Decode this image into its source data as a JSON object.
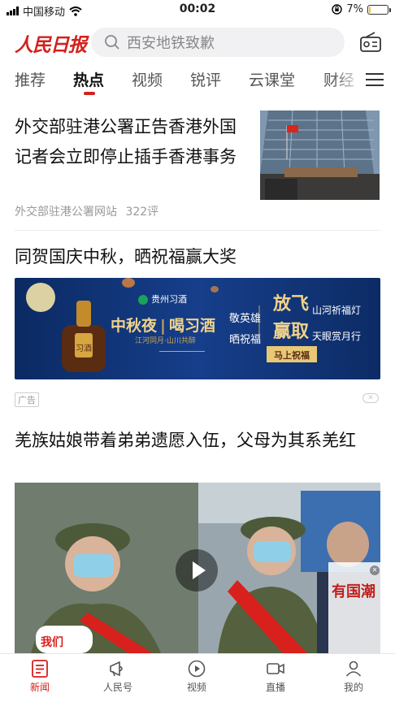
{
  "status_bar": {
    "carrier": "中国移动",
    "time": "00:02",
    "battery_percent": "7%",
    "battery_level": 0.07,
    "icons": [
      "signal-icon",
      "wifi-icon",
      "orientation-lock-icon",
      "battery-icon"
    ]
  },
  "header": {
    "logo_text": "人民日报",
    "search_placeholder": "西安地铁致歉",
    "search_icon": "search-icon",
    "radio_icon": "radio-icon"
  },
  "tabs": [
    {
      "label": "推荐",
      "active": false
    },
    {
      "label": "热点",
      "active": true
    },
    {
      "label": "视频",
      "active": false
    },
    {
      "label": "锐评",
      "active": false
    },
    {
      "label": "云课堂",
      "active": false
    },
    {
      "label": "财经",
      "active": false
    }
  ],
  "tab_menu_icon": "menu-icon",
  "feed": {
    "article1": {
      "title": "外交部驻港公署正告香港外国记者会立即停止插手香港事务",
      "source": "外交部驻港公署网站",
      "comments": "322评"
    },
    "article2": {
      "title": "同贺国庆中秋，晒祝福赢大奖",
      "ad": {
        "brand": "贵州习酒",
        "line1_a": "中秋夜",
        "line1_b": "喝习酒",
        "sub": "江河同月·山川共醉",
        "p1": "敬英雄",
        "p2": "晒祝福",
        "big1": "放飞",
        "big2": "赢取",
        "r1": "山河祈福灯",
        "r2": "天眼赏月行",
        "cta": "马上祝福",
        "bottle_label": "习酒"
      },
      "ad_tag": "广告",
      "ad_close": "✕"
    },
    "article3": {
      "title": "羌族姑娘带着弟弟遗愿入伍，父母为其系羌红",
      "video_badge": "有国潮",
      "video_stamp": "我们"
    }
  },
  "tabbar": [
    {
      "label": "新闻",
      "icon": "news-icon",
      "active": true
    },
    {
      "label": "人民号",
      "icon": "megaphone-icon",
      "active": false
    },
    {
      "label": "视频",
      "icon": "play-circle-icon",
      "active": false
    },
    {
      "label": "直播",
      "icon": "camera-icon",
      "active": false
    },
    {
      "label": "我的",
      "icon": "person-icon",
      "active": false
    }
  ],
  "colors": {
    "brand_red": "#d4211d",
    "ad_blue": "#163e8a",
    "battery_yellow": "#f5c518"
  }
}
